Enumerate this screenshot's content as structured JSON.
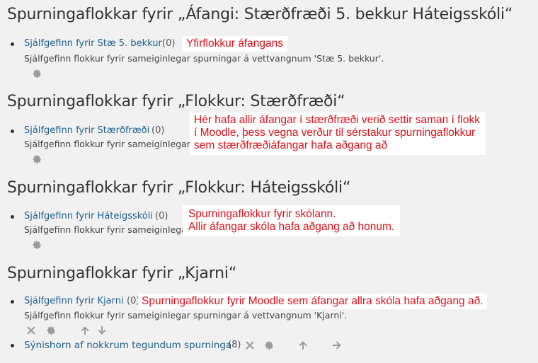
{
  "sections": [
    {
      "heading": "Spurningaflokkar fyrir „Áfangi: Stærðfræði 5. bekkur Háteigsskóli“",
      "category_link": "Sjálfgefinn fyrir Stæ 5. bekkur",
      "count": "(0)",
      "description": "Sjálfgefinn flokkur fyrir sameiginlegar spurningar á vettvangnum 'Stæ 5. bekkur'.",
      "note_lines": [
        "Yfirflokkur áfangans"
      ]
    },
    {
      "heading": "Spurningaflokkar fyrir „Flokkur: Stærðfræði“",
      "category_link": "Sjálfgefinn fyrir Stærðfræði",
      "count": "(0)",
      "description": "Sjálfgefinn flokkur fyrir sameiginlegar spurningar á vettvangnum 'Stærðfræði'.",
      "note_lines": [
        "Hér hafa allir áfangar í stærðfræði verið settir saman í flokk",
        "í Moodle, þess vegna verður til sérstakur spurningaflokkur",
        "sem stærðfræðiáfangar hafa aðgang að"
      ]
    },
    {
      "heading": "Spurningaflokkar fyrir „Flokkur: Háteigsskóli“",
      "category_link": "Sjálfgefinn fyrir Háteigsskóli",
      "count": "(0)",
      "description": "Sjálfgefinn flokkur fyrir sameiginlegar spurningar á vettvangnum 'Háteigsskóli'.",
      "note_lines": [
        "Spurningaflokkur fyrir skólann.",
        "Allir áfangar skóla hafa aðgang að honum."
      ]
    },
    {
      "heading": "Spurningaflokkar fyrir „Kjarni“",
      "category_link": "Sjálfgefinn fyrir Kjarni",
      "count": "(0)",
      "description": "Sjálfgefinn flokkur fyrir sameiginlegar spurningar á vettvangnum 'Kjarni'.",
      "note_lines": [
        "Spurningaflokkur fyrir Moodle sem áfangar allra skóla hafa aðgang að."
      ],
      "sub_category_link": "Sýnishorn af nokkrum tegundum spurninga",
      "sub_category_count": "(8)"
    }
  ],
  "icons": {
    "delete": "close-icon",
    "edit": "gear-icon",
    "move_up": "arrow-up-icon",
    "move_down": "arrow-down-icon",
    "move_right": "arrow-right-icon"
  },
  "colors": {
    "link": "#1f5e8e",
    "note_text": "#e0101a",
    "note_bg": "#ffffff",
    "icon": "#9a9a9a",
    "background": "#f1f1f1"
  }
}
